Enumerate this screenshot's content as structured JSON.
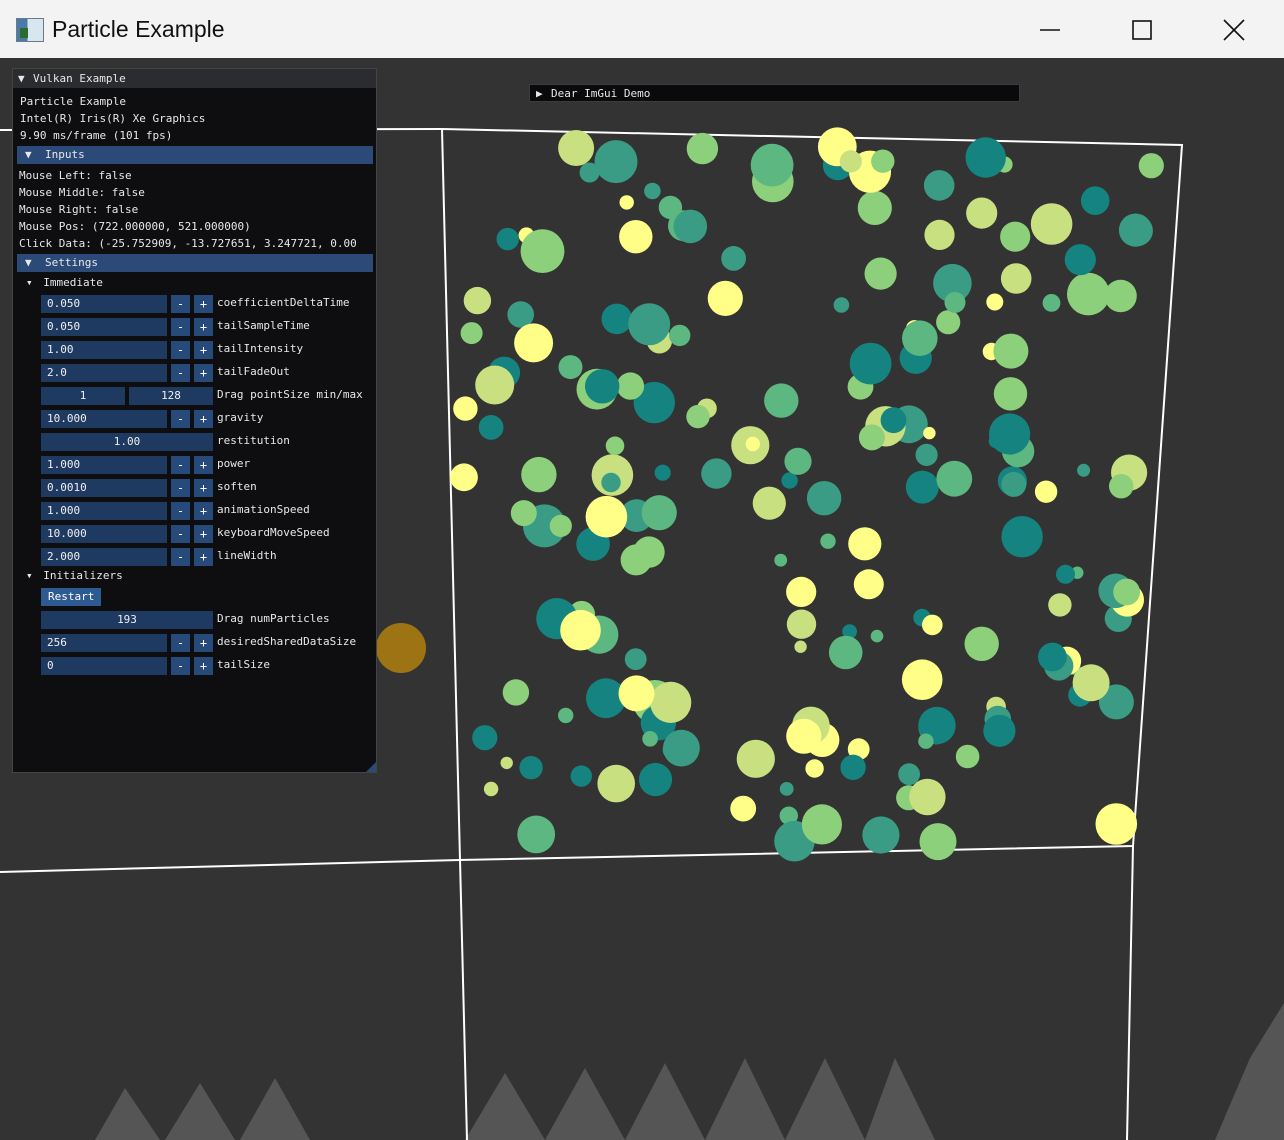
{
  "window": {
    "title": "Particle Example",
    "icon": "app-window-icon",
    "buttons": [
      "minimize-icon",
      "maximize-icon",
      "close-icon"
    ]
  },
  "panel": {
    "title": "Vulkan Example",
    "app_name": "Particle Example",
    "gpu": "Intel(R) Iris(R) Xe Graphics",
    "frame_stats": "9.90 ms/frame (101 fps)",
    "inputs": {
      "header": "Inputs",
      "mouse_left": "Mouse Left: false",
      "mouse_middle": "Mouse Middle: false",
      "mouse_right": "Mouse Right: false",
      "mouse_pos": "Mouse Pos: (722.000000, 521.000000)",
      "click_data": "Click Data: (-25.752909, -13.727651, 3.247721, 0.00"
    },
    "settings": {
      "header": "Settings",
      "immediate": {
        "label": "Immediate",
        "rows": [
          {
            "value": "0.050",
            "label": "coefficientDeltaTime"
          },
          {
            "value": "0.050",
            "label": "tailSampleTime"
          },
          {
            "value": "1.00",
            "label": "tailIntensity"
          },
          {
            "value": "2.0",
            "label": "tailFadeOut"
          }
        ],
        "point_size": {
          "min": "1",
          "max": "128",
          "label": "Drag pointSize min/max"
        },
        "gravity": {
          "value": "10.000",
          "label": "gravity"
        },
        "restitution": {
          "value": "1.00",
          "label": "restitution"
        },
        "rows2": [
          {
            "value": "1.000",
            "label": "power"
          },
          {
            "value": "0.0010",
            "label": "soften"
          },
          {
            "value": "1.000",
            "label": "animationSpeed"
          },
          {
            "value": "10.000",
            "label": "keyboardMoveSpeed"
          },
          {
            "value": "2.000",
            "label": "lineWidth"
          }
        ]
      },
      "initializers": {
        "label": "Initializers",
        "restart_label": "Restart",
        "num_particles": {
          "value": "193",
          "label": "Drag numParticles"
        },
        "shared_data": {
          "value": "256",
          "label": "desiredSharedDataSize"
        },
        "tail_size": {
          "value": "0",
          "label": "tailSize"
        }
      }
    },
    "minus": "-",
    "plus": "+"
  },
  "demo_window": {
    "title": "Dear ImGui Demo"
  },
  "colors": {
    "accent_header": "#2c4a78",
    "field_bg": "#1f3a60",
    "button_bg": "#264a7a",
    "particle_palette": [
      "#ffff88",
      "#c8e080",
      "#8cd07c",
      "#5cb880",
      "#3a9c84",
      "#15837f"
    ]
  }
}
